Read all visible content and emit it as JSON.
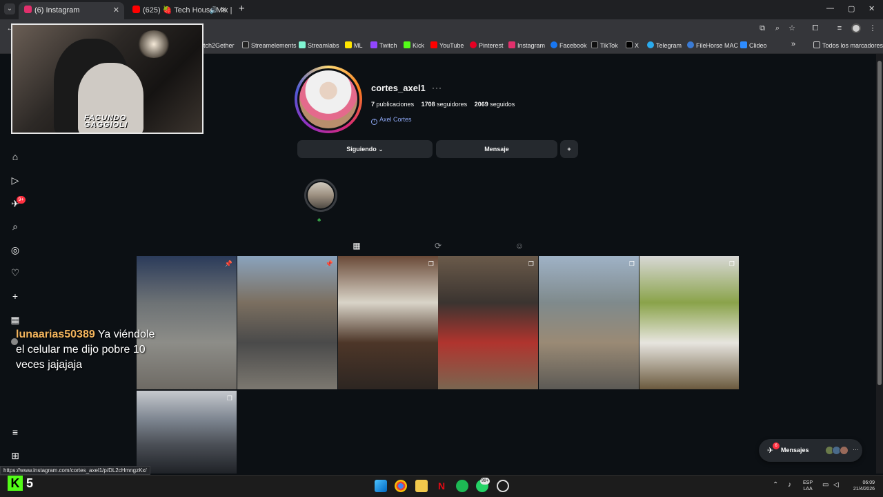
{
  "browser": {
    "tabs": [
      {
        "title": "(6) Instagram",
        "favicon_color": "#e1306c",
        "active": true
      },
      {
        "title": "(625) 🍓 Tech House Mix | ",
        "favicon_color": "#ff0000",
        "active": false
      }
    ],
    "new_tab": "+",
    "window_controls": [
      "—",
      "▢",
      "✕"
    ],
    "bookmarks": [
      {
        "label": "atch2Gether",
        "color": "#555555"
      },
      {
        "label": "Streamelements",
        "color": "#222222"
      },
      {
        "label": "Streamlabs",
        "color": "#80f5d2"
      },
      {
        "label": "ML",
        "color": "#ffe600"
      },
      {
        "label": "Twitch",
        "color": "#9146ff"
      },
      {
        "label": "Kick",
        "color": "#53fc18"
      },
      {
        "label": "YouTube",
        "color": "#ff0000"
      },
      {
        "label": "Pinterest",
        "color": "#e60023"
      },
      {
        "label": "Instagram",
        "color": "#e1306c"
      },
      {
        "label": "Facebook",
        "color": "#1877f2"
      },
      {
        "label": "TikTok",
        "color": "#111111"
      },
      {
        "label": "X",
        "color": "#000000"
      },
      {
        "label": "Telegram",
        "color": "#2aabee"
      },
      {
        "label": "FileHorse MAC",
        "color": "#3a7bd5"
      },
      {
        "label": "Clideo",
        "color": "#2d8cff"
      }
    ],
    "bookmarks_overflow": "»",
    "all_bookmarks": "Todos los marcadores"
  },
  "sidebar": {
    "notification_badge": "9+"
  },
  "profile": {
    "username": "cortes_axel1",
    "more": "···",
    "posts_count": "7",
    "posts_label": "publicaciones",
    "followers_count": "1708",
    "followers_label": "seguidores",
    "following_count": "2069",
    "following_label": "seguidos",
    "facebook_link": "Axel Cortes",
    "following_button": "Siguiendo",
    "message_button": "Mensaje",
    "add_user_button": "+"
  },
  "posts": [
    {
      "marker": "📌",
      "colors": [
        "#2b3b5a",
        "#6d7275",
        "#8d8d88",
        "#6e6a64"
      ]
    },
    {
      "marker": "📌",
      "colors": [
        "#8aa3bd",
        "#7b6f60",
        "#4a4a4a",
        "#7c7870"
      ]
    },
    {
      "marker": "❐",
      "colors": [
        "#6a4a38",
        "#d9d4c8",
        "#4d3628",
        "#2d2622"
      ]
    },
    {
      "marker": "❐",
      "colors": [
        "#6a5a4a",
        "#3b3430",
        "#b0342e",
        "#7a6650"
      ]
    },
    {
      "marker": "❐",
      "colors": [
        "#9fb2c6",
        "#7f8a8c",
        "#9a8a75",
        "#5c5a55"
      ]
    },
    {
      "marker": "❐",
      "colors": [
        "#d8d8d6",
        "#8aa34a",
        "#e7e5df",
        "#6b5a3e"
      ]
    },
    {
      "marker": "❐",
      "colors": [
        "#c6c9ce",
        "#7d8590",
        "#4b4f56",
        "#1f2227"
      ]
    }
  ],
  "overlay": {
    "cam_watermark_line1": "FACUNDO",
    "cam_watermark_line2": "GAGGIOLI",
    "chat_user": "lunaarias50389",
    "chat_message": " Ya viéndole el celular me dijo pobre 10 veces jajajaja",
    "kick_viewers": "5",
    "kick_logo": "K"
  },
  "messages": {
    "label": "Mensajes",
    "badge": "6",
    "avatar_colors": [
      "#6a7a4a",
      "#4a6a8a",
      "#9a6a5a"
    ],
    "more": "···"
  },
  "status_url": "https://www.instagram.com/cortes_axel1/p/DL2cHmngzKx/",
  "taskbar": {
    "whatsapp_badge": "99+",
    "language_line1": "ESP",
    "language_line2": "LAA",
    "time": "06:09",
    "date": "21/4/2026"
  },
  "colors": {
    "accent_blue": "#8ea8f5",
    "background": "#0c1014",
    "button_bg": "#25292e",
    "notification": "#ff3040"
  }
}
